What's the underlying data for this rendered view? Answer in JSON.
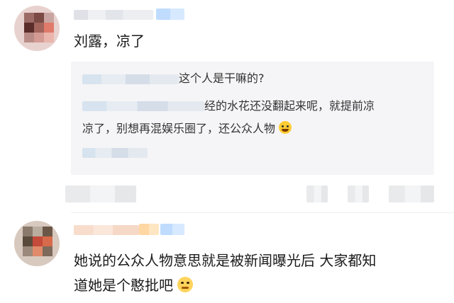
{
  "comment": {
    "text": "刘露，凉了"
  },
  "reply": {
    "line1_suffix": "这个人是干嘛的?",
    "line2_suffix": "经的水花还没翻起来呢，就提前凉",
    "line3": "凉了，别想再混娱乐圈了，还公众人物"
  },
  "comment2": {
    "line1": "她说的公众人物意思就是被新闻曝光后 大家都知",
    "line2": "道她是个憨批吧"
  },
  "icons": {
    "emoji1": "crying-laugh-emoji-icon",
    "emoji2": "smirk-emoji-icon"
  },
  "colors": {
    "reply_bg": "#f5f5f7",
    "text": "#1b1b1b",
    "badge_blue": "#bfdcff"
  }
}
